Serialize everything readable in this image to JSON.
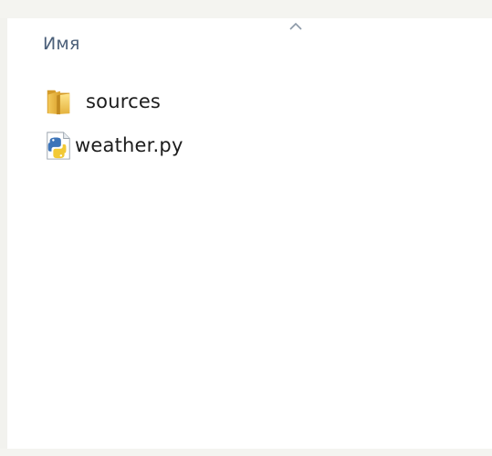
{
  "file_list": {
    "column_header": {
      "name_label": "Имя",
      "sort_icon": "sort-ascending-icon"
    },
    "items": [
      {
        "name": "sources",
        "type": "folder",
        "icon": "folder-icon"
      },
      {
        "name": "weather.py",
        "type": "file",
        "icon": "python-file-icon"
      }
    ]
  }
}
